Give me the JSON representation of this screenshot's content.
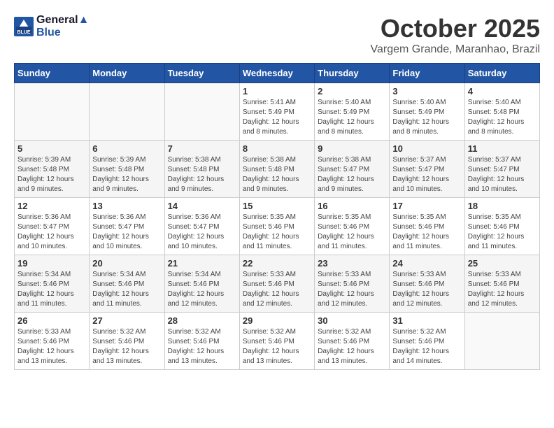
{
  "header": {
    "logo_line1": "General",
    "logo_line2": "Blue",
    "month": "October 2025",
    "location": "Vargem Grande, Maranhao, Brazil"
  },
  "days_of_week": [
    "Sunday",
    "Monday",
    "Tuesday",
    "Wednesday",
    "Thursday",
    "Friday",
    "Saturday"
  ],
  "weeks": [
    [
      {
        "day": "",
        "sunrise": "",
        "sunset": "",
        "daylight": ""
      },
      {
        "day": "",
        "sunrise": "",
        "sunset": "",
        "daylight": ""
      },
      {
        "day": "",
        "sunrise": "",
        "sunset": "",
        "daylight": ""
      },
      {
        "day": "1",
        "sunrise": "Sunrise: 5:41 AM",
        "sunset": "Sunset: 5:49 PM",
        "daylight": "Daylight: 12 hours and 8 minutes."
      },
      {
        "day": "2",
        "sunrise": "Sunrise: 5:40 AM",
        "sunset": "Sunset: 5:49 PM",
        "daylight": "Daylight: 12 hours and 8 minutes."
      },
      {
        "day": "3",
        "sunrise": "Sunrise: 5:40 AM",
        "sunset": "Sunset: 5:49 PM",
        "daylight": "Daylight: 12 hours and 8 minutes."
      },
      {
        "day": "4",
        "sunrise": "Sunrise: 5:40 AM",
        "sunset": "Sunset: 5:48 PM",
        "daylight": "Daylight: 12 hours and 8 minutes."
      }
    ],
    [
      {
        "day": "5",
        "sunrise": "Sunrise: 5:39 AM",
        "sunset": "Sunset: 5:48 PM",
        "daylight": "Daylight: 12 hours and 9 minutes."
      },
      {
        "day": "6",
        "sunrise": "Sunrise: 5:39 AM",
        "sunset": "Sunset: 5:48 PM",
        "daylight": "Daylight: 12 hours and 9 minutes."
      },
      {
        "day": "7",
        "sunrise": "Sunrise: 5:38 AM",
        "sunset": "Sunset: 5:48 PM",
        "daylight": "Daylight: 12 hours and 9 minutes."
      },
      {
        "day": "8",
        "sunrise": "Sunrise: 5:38 AM",
        "sunset": "Sunset: 5:48 PM",
        "daylight": "Daylight: 12 hours and 9 minutes."
      },
      {
        "day": "9",
        "sunrise": "Sunrise: 5:38 AM",
        "sunset": "Sunset: 5:47 PM",
        "daylight": "Daylight: 12 hours and 9 minutes."
      },
      {
        "day": "10",
        "sunrise": "Sunrise: 5:37 AM",
        "sunset": "Sunset: 5:47 PM",
        "daylight": "Daylight: 12 hours and 10 minutes."
      },
      {
        "day": "11",
        "sunrise": "Sunrise: 5:37 AM",
        "sunset": "Sunset: 5:47 PM",
        "daylight": "Daylight: 12 hours and 10 minutes."
      }
    ],
    [
      {
        "day": "12",
        "sunrise": "Sunrise: 5:36 AM",
        "sunset": "Sunset: 5:47 PM",
        "daylight": "Daylight: 12 hours and 10 minutes."
      },
      {
        "day": "13",
        "sunrise": "Sunrise: 5:36 AM",
        "sunset": "Sunset: 5:47 PM",
        "daylight": "Daylight: 12 hours and 10 minutes."
      },
      {
        "day": "14",
        "sunrise": "Sunrise: 5:36 AM",
        "sunset": "Sunset: 5:47 PM",
        "daylight": "Daylight: 12 hours and 10 minutes."
      },
      {
        "day": "15",
        "sunrise": "Sunrise: 5:35 AM",
        "sunset": "Sunset: 5:46 PM",
        "daylight": "Daylight: 12 hours and 11 minutes."
      },
      {
        "day": "16",
        "sunrise": "Sunrise: 5:35 AM",
        "sunset": "Sunset: 5:46 PM",
        "daylight": "Daylight: 12 hours and 11 minutes."
      },
      {
        "day": "17",
        "sunrise": "Sunrise: 5:35 AM",
        "sunset": "Sunset: 5:46 PM",
        "daylight": "Daylight: 12 hours and 11 minutes."
      },
      {
        "day": "18",
        "sunrise": "Sunrise: 5:35 AM",
        "sunset": "Sunset: 5:46 PM",
        "daylight": "Daylight: 12 hours and 11 minutes."
      }
    ],
    [
      {
        "day": "19",
        "sunrise": "Sunrise: 5:34 AM",
        "sunset": "Sunset: 5:46 PM",
        "daylight": "Daylight: 12 hours and 11 minutes."
      },
      {
        "day": "20",
        "sunrise": "Sunrise: 5:34 AM",
        "sunset": "Sunset: 5:46 PM",
        "daylight": "Daylight: 12 hours and 11 minutes."
      },
      {
        "day": "21",
        "sunrise": "Sunrise: 5:34 AM",
        "sunset": "Sunset: 5:46 PM",
        "daylight": "Daylight: 12 hours and 12 minutes."
      },
      {
        "day": "22",
        "sunrise": "Sunrise: 5:33 AM",
        "sunset": "Sunset: 5:46 PM",
        "daylight": "Daylight: 12 hours and 12 minutes."
      },
      {
        "day": "23",
        "sunrise": "Sunrise: 5:33 AM",
        "sunset": "Sunset: 5:46 PM",
        "daylight": "Daylight: 12 hours and 12 minutes."
      },
      {
        "day": "24",
        "sunrise": "Sunrise: 5:33 AM",
        "sunset": "Sunset: 5:46 PM",
        "daylight": "Daylight: 12 hours and 12 minutes."
      },
      {
        "day": "25",
        "sunrise": "Sunrise: 5:33 AM",
        "sunset": "Sunset: 5:46 PM",
        "daylight": "Daylight: 12 hours and 12 minutes."
      }
    ],
    [
      {
        "day": "26",
        "sunrise": "Sunrise: 5:33 AM",
        "sunset": "Sunset: 5:46 PM",
        "daylight": "Daylight: 12 hours and 13 minutes."
      },
      {
        "day": "27",
        "sunrise": "Sunrise: 5:32 AM",
        "sunset": "Sunset: 5:46 PM",
        "daylight": "Daylight: 12 hours and 13 minutes."
      },
      {
        "day": "28",
        "sunrise": "Sunrise: 5:32 AM",
        "sunset": "Sunset: 5:46 PM",
        "daylight": "Daylight: 12 hours and 13 minutes."
      },
      {
        "day": "29",
        "sunrise": "Sunrise: 5:32 AM",
        "sunset": "Sunset: 5:46 PM",
        "daylight": "Daylight: 12 hours and 13 minutes."
      },
      {
        "day": "30",
        "sunrise": "Sunrise: 5:32 AM",
        "sunset": "Sunset: 5:46 PM",
        "daylight": "Daylight: 12 hours and 13 minutes."
      },
      {
        "day": "31",
        "sunrise": "Sunrise: 5:32 AM",
        "sunset": "Sunset: 5:46 PM",
        "daylight": "Daylight: 12 hours and 14 minutes."
      },
      {
        "day": "",
        "sunrise": "",
        "sunset": "",
        "daylight": ""
      }
    ]
  ]
}
